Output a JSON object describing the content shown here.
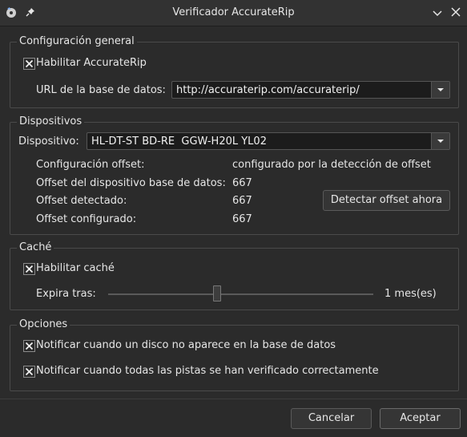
{
  "window": {
    "title": "Verificador AccurateRip"
  },
  "general": {
    "legend": "Configuración general",
    "enable_label": "Habilitar AccurateRip",
    "enable_checked": true,
    "url_label": "URL de la base de datos:",
    "url_value": "http://accuraterip.com/accuraterip/"
  },
  "devices": {
    "legend": "Dispositivos",
    "device_label": "Dispositivo:",
    "device_value": "HL-DT-ST BD-RE  GGW-H20L YL02",
    "rows": [
      {
        "label": "Configuración offset:",
        "value": "configurado por la detección de offset"
      },
      {
        "label": "Offset del dispositivo base de datos:",
        "value": "667"
      },
      {
        "label": "Offset detectado:",
        "value": "667"
      },
      {
        "label": "Offset configurado:",
        "value": "667"
      }
    ],
    "detect_button": "Detectar offset ahora"
  },
  "cache": {
    "legend": "Caché",
    "enable_label": "Habilitar caché",
    "enable_checked": true,
    "expire_label": "Expira tras:",
    "expire_value": "1 mes(es)",
    "slider_fraction": 0.41
  },
  "options": {
    "legend": "Opciones",
    "notify_missing_label": "Notificar cuando un disco no aparece en la base de datos",
    "notify_missing_checked": true,
    "notify_verified_label": "Notificar cuando todas las pistas se han verificado correctamente",
    "notify_verified_checked": true
  },
  "footer": {
    "cancel_label": "Cancelar",
    "accept_label": "Aceptar"
  },
  "icons": {
    "app": "app-icon",
    "pin": "pin-icon",
    "minimize": "chevron-down-icon",
    "close": "close-icon",
    "check": "check-icon",
    "dropdown": "chevron-down-icon"
  },
  "colors": {
    "background": "#2b2b2b",
    "text": "#e6e6e6",
    "input_background": "#1c1c1c",
    "border": "#4a4a4a"
  }
}
